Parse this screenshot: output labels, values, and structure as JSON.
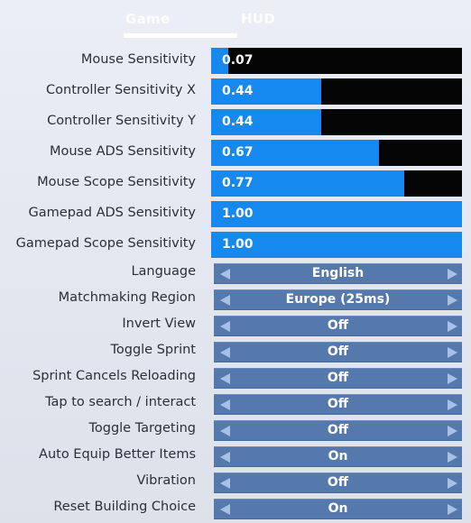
{
  "tabs": [
    {
      "label": "Game",
      "active": true
    },
    {
      "label": "HUD",
      "active": false
    }
  ],
  "sliders": [
    {
      "label": "Mouse Sensitivity",
      "value": "0.07",
      "fraction": 0.07
    },
    {
      "label": "Controller Sensitivity X",
      "value": "0.44",
      "fraction": 0.44
    },
    {
      "label": "Controller Sensitivity Y",
      "value": "0.44",
      "fraction": 0.44
    },
    {
      "label": "Mouse ADS Sensitivity",
      "value": "0.67",
      "fraction": 0.67
    },
    {
      "label": "Mouse Scope Sensitivity",
      "value": "0.77",
      "fraction": 0.77
    },
    {
      "label": "Gamepad ADS Sensitivity",
      "value": "1.00",
      "fraction": 1.0
    },
    {
      "label": "Gamepad Scope Sensitivity",
      "value": "1.00",
      "fraction": 1.0
    }
  ],
  "selectors": [
    {
      "label": "Language",
      "value": "English"
    },
    {
      "label": "Matchmaking Region",
      "value": "Europe (25ms)"
    },
    {
      "label": "Invert View",
      "value": "Off"
    },
    {
      "label": "Toggle Sprint",
      "value": "Off"
    },
    {
      "label": "Sprint Cancels Reloading",
      "value": "Off"
    },
    {
      "label": "Tap to search / interact",
      "value": "Off"
    },
    {
      "label": "Toggle Targeting",
      "value": "Off"
    },
    {
      "label": "Auto Equip Better Items",
      "value": "On"
    },
    {
      "label": "Vibration",
      "value": "Off"
    },
    {
      "label": "Reset Building Choice",
      "value": "On"
    }
  ],
  "colors": {
    "slider_fill": "#1589f0",
    "slider_track": "#050505",
    "selector_bg": "#5679ad",
    "arrow": "#a6c0e6"
  },
  "icons": {
    "left": "triangle-left",
    "right": "triangle-right"
  }
}
